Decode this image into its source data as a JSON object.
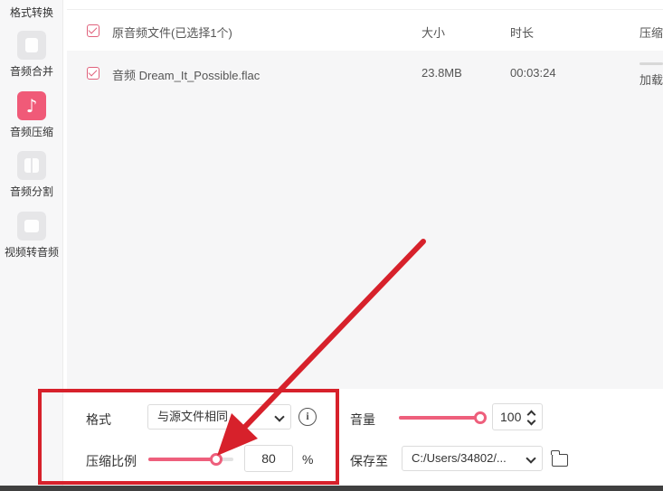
{
  "sidebar": {
    "items": [
      {
        "label": "格式转换"
      },
      {
        "label": "音频合并"
      },
      {
        "label": "音频压缩"
      },
      {
        "label": "音频分割"
      },
      {
        "label": "视频转音频"
      }
    ],
    "active_index": 2
  },
  "table": {
    "header": {
      "name": "原音频文件(已选择1个)",
      "size": "大小",
      "duration": "时长",
      "compress": "压缩"
    },
    "rows": [
      {
        "name": "音频 Dream_It_Possible.flac",
        "size": "23.8MB",
        "duration": "00:03:24",
        "status": "加载"
      }
    ]
  },
  "controls": {
    "format_label": "格式",
    "format_value": "与源文件相同",
    "ratio_label": "压缩比例",
    "ratio_value": "80",
    "ratio_unit": "%",
    "ratio_level": 0.8,
    "volume_label": "音量",
    "volume_value": "100",
    "volume_level": 1.0,
    "save_label": "保存至",
    "save_path": "C:/Users/34802/..."
  },
  "colors": {
    "accent": "#ee5f7c",
    "annotation": "#d7212b"
  }
}
